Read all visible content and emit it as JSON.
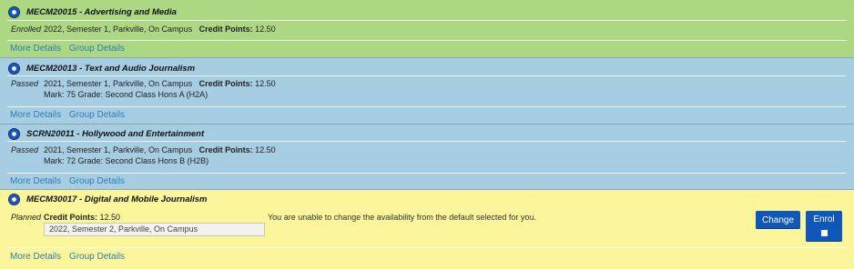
{
  "subjects": [
    {
      "code_title": "MECM20015 - Advertising and Media",
      "status": "Enrolled",
      "details": "2022, Semester 1, Parkville, On Campus",
      "credit_label": "Credit Points:",
      "credit_value": "12.50",
      "mark": "",
      "links": [
        "More Details",
        "Group Details"
      ]
    },
    {
      "code_title": "MECM20013 - Text and Audio Journalism",
      "status": "Passed",
      "details": "2021, Semester 1, Parkville, On Campus",
      "credit_label": "Credit Points:",
      "credit_value": "12.50",
      "mark": "Mark: 75 Grade: Second Class Hons A (H2A)",
      "links": [
        "More Details",
        "Group Details"
      ]
    },
    {
      "code_title": "SCRN20011 - Hollywood and Entertainment",
      "status": "Passed",
      "details": "2021, Semester 1, Parkville, On Campus",
      "credit_label": "Credit Points:",
      "credit_value": "12.50",
      "mark": "Mark: 72 Grade: Second Class Hons B (H2B)",
      "links": [
        "More Details",
        "Group Details"
      ]
    },
    {
      "code_title": "MECM30017 - Digital and Mobile Journalism",
      "status": "Planned",
      "credit_label": "Credit Points:",
      "credit_value": "12.50",
      "availability_value": "2022,  Semester 2,  Parkville,  On Campus",
      "message": "You are unable to change the availability from the default selected for you.",
      "change_label": "Change",
      "enrol_label": "Enrol",
      "links": [
        "More Details",
        "Group Details"
      ]
    }
  ],
  "colors": {
    "enrolled": "#acd884",
    "passed": "#a7cde2",
    "planned": "#fbf59b",
    "link": "#2e7db8",
    "button": "#0f57b8"
  },
  "icons": {
    "subject_bullet": "bullet-icon",
    "enrol_checkbox": "checkbox-icon"
  }
}
